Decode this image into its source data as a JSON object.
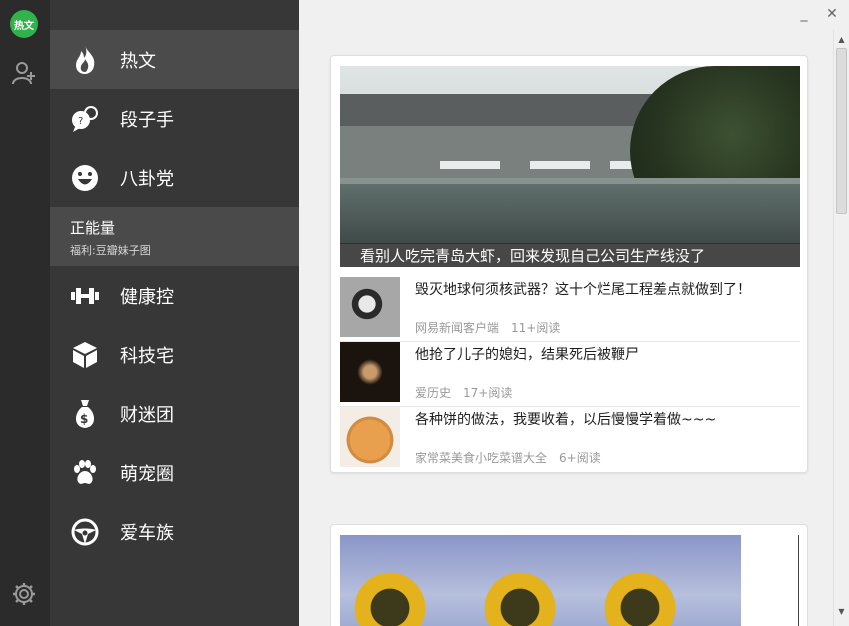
{
  "app": {
    "logo_text": "热文",
    "logo_color": "#2fb34a"
  },
  "rail": {
    "add_user_icon": "add-user-icon",
    "settings_icon": "gear-icon"
  },
  "window": {
    "minimize_label": "_",
    "close_label": "✕"
  },
  "nav": {
    "items": [
      {
        "label": "热文",
        "icon": "flame-icon"
      },
      {
        "label": "段子手",
        "icon": "speech-bubbles-icon"
      },
      {
        "label": "八卦党",
        "icon": "laughing-face-icon"
      },
      {
        "label": "健康控",
        "icon": "dumbbell-icon"
      },
      {
        "label": "科技宅",
        "icon": "cube-icon"
      },
      {
        "label": "财迷团",
        "icon": "money-bag-icon"
      },
      {
        "label": "萌宠圈",
        "icon": "paw-icon"
      },
      {
        "label": "爱车族",
        "icon": "steering-wheel-icon"
      }
    ],
    "feature": {
      "title": "正能量",
      "subtitle": "福利:豆瓣妹子图"
    }
  },
  "feed": {
    "card1": {
      "headline": "看别人吃完青岛大虾，回来发现自己公司生产线没了",
      "items": [
        {
          "title": "毁灭地球何须核武器？这十个烂尾工程差点就做到了！",
          "source": "网易新闻客户端",
          "reads": "11+阅读"
        },
        {
          "title": "他抢了儿子的媳妇，结果死后被鞭尸",
          "source": "爱历史",
          "reads": "17+阅读"
        },
        {
          "title": "各种饼的做法，我要收着，以后慢慢学着做~~~",
          "source": "家常菜美食小吃菜谱大全",
          "reads": "6+阅读"
        }
      ]
    }
  },
  "scrollbar": {
    "up_arrow": "▲",
    "down_arrow": "▼"
  }
}
